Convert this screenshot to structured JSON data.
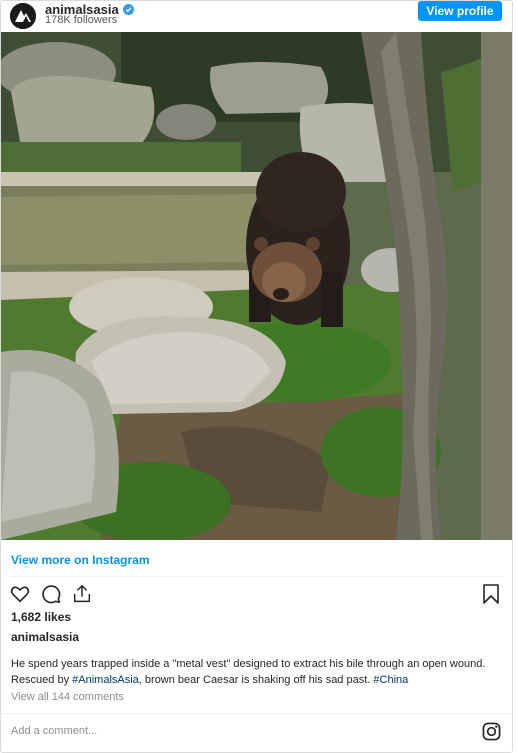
{
  "header": {
    "username": "animalsasia",
    "followers": "178K followers",
    "view_profile_label": "View profile"
  },
  "media": {
    "alt": "Bear in grassy rocky enclosure",
    "icon": "video-frame"
  },
  "post": {
    "view_more_label": "View more on Instagram",
    "likes": "1,682 likes",
    "caption_user": "animalsasia",
    "caption_part1": "He spend years trapped inside a \"metal vest\" designed to extract his bile through an open wound. Rescued by ",
    "hashtag1": "#AnimalsAsia",
    "caption_part2": ", brown bear Caesar is shaking off his sad past. ",
    "hashtag2": "#China",
    "comments_link": "View all 144 comments",
    "add_comment_placeholder": "Add a comment..."
  },
  "icons": {
    "like": "heart-icon",
    "comment": "comment-icon",
    "share": "share-icon",
    "save": "bookmark-icon",
    "instagram": "instagram-icon",
    "verified": "verified-badge-icon"
  },
  "colors": {
    "accent": "#0095f6",
    "hashtag": "#00376b",
    "muted": "#8e8e8e"
  }
}
